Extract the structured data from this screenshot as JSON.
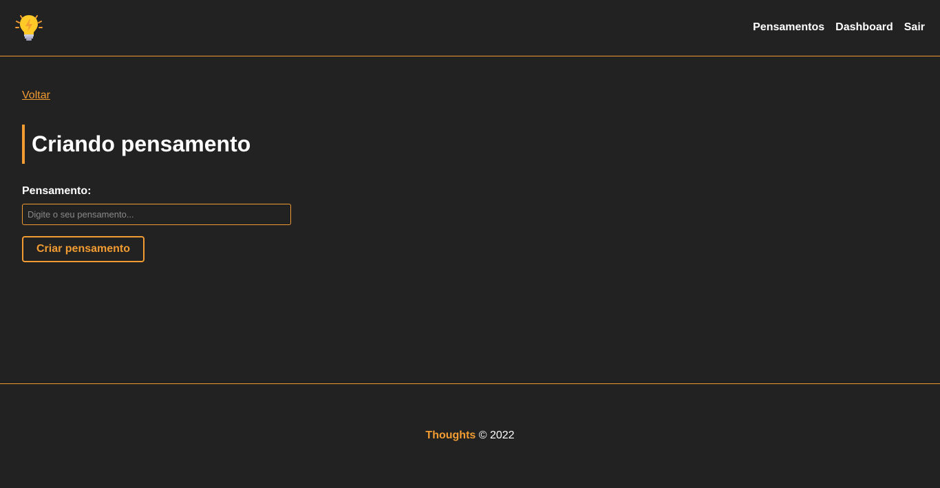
{
  "navbar": {
    "logo_icon": "lightbulb-icon",
    "links": [
      {
        "label": "Pensamentos"
      },
      {
        "label": "Dashboard"
      },
      {
        "label": "Sair"
      }
    ]
  },
  "main": {
    "back_link": "Voltar",
    "title": "Criando pensamento",
    "form": {
      "field_label": "Pensamento:",
      "field_value": "",
      "field_placeholder": "Digite o seu pensamento...",
      "submit_label": "Criar pensamento"
    }
  },
  "footer": {
    "brand": "Thoughts",
    "copyright": "© 2022"
  },
  "colors": {
    "background": "#222222",
    "accent": "#f39c32",
    "text": "#ffffff"
  }
}
